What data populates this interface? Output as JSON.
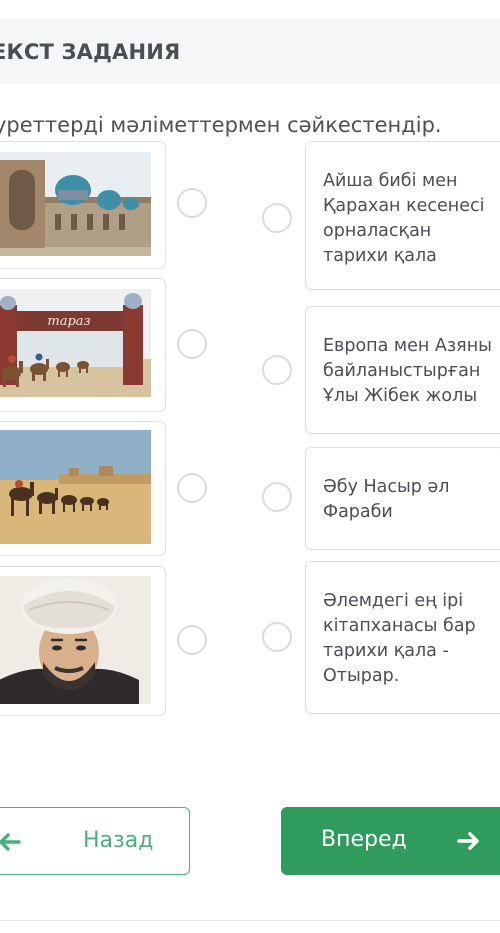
{
  "header": {
    "title": "ЕКСТ ЗАДАНИЯ"
  },
  "task": {
    "instruction": "уреттерді мәліметтермен сәйкестендір."
  },
  "images": [
    {
      "subject": "mausoleum",
      "alt": "Mausoleum with blue domes"
    },
    {
      "subject": "city-gate",
      "alt": "Taraz city gate with camel caravan",
      "sign_text": "тараз"
    },
    {
      "subject": "caravan",
      "alt": "Camel caravan in the desert"
    },
    {
      "subject": "portrait",
      "alt": "Portrait of a scholar in a white turban"
    }
  ],
  "options": [
    {
      "text": "Айша бибі мен Қарахан кесенесі орналасқан тарихи қала"
    },
    {
      "text": "Европа мен Азяны байланыстырған Ұлы Жібек жолы"
    },
    {
      "text": "Әбу Насыр әл Фараби"
    },
    {
      "text": "Әлемдегі ең ірі кітапханасы бар тарихи қала - Отырар."
    }
  ],
  "navigation": {
    "back_label": "Назад",
    "next_label": "Вперед"
  },
  "colors": {
    "accent": "#2f9b5c",
    "accent_outline": "#49b27b",
    "header_bg": "#f4f6f8",
    "border": "#dde1e5"
  }
}
